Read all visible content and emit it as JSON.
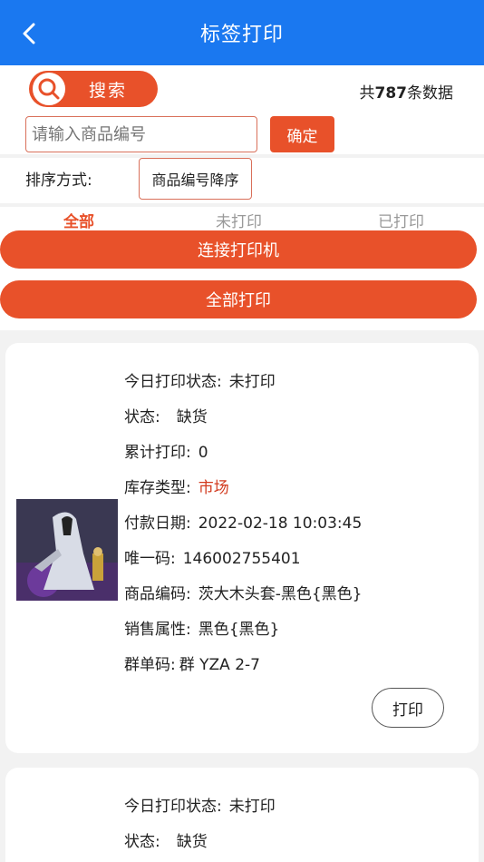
{
  "header": {
    "title": "标签打印"
  },
  "search": {
    "button_label": "搜索",
    "count_prefix": "共",
    "count_value": "787",
    "count_suffix": "条数据",
    "input_placeholder": "请输入商品编号",
    "confirm_label": "确定"
  },
  "sort": {
    "label": "排序方式:",
    "value": "商品编号降序"
  },
  "tabs": [
    {
      "label": "全部",
      "active": true
    },
    {
      "label": "未打印",
      "active": false
    },
    {
      "label": "已打印",
      "active": false
    }
  ],
  "actions": {
    "connect_label": "连接打印机",
    "print_all_label": "全部打印"
  },
  "cards": [
    {
      "rows": [
        {
          "label": "今日打印状态:",
          "value": "未打印"
        },
        {
          "label": "状态:",
          "value": "缺货"
        },
        {
          "label": "累计打印:",
          "value": "0"
        },
        {
          "label": "库存类型:",
          "value": "市场"
        },
        {
          "label": "付款日期:",
          "value": "2022-02-18 10:03:45"
        },
        {
          "label": "唯一码:",
          "value": "146002755401"
        },
        {
          "label": "商品编码:",
          "value": "茨大木头套-黑色{黑色}"
        },
        {
          "label": "销售属性:",
          "value": "黑色{黑色}"
        },
        {
          "label": "群单码:",
          "value": "群 YZA 2-7"
        }
      ],
      "print_label": "打印"
    },
    {
      "rows": [
        {
          "label": "今日打印状态:",
          "value": "未打印"
        },
        {
          "label": "状态:",
          "value": "缺货"
        }
      ]
    }
  ],
  "colors": {
    "header": "#1a78f0",
    "accent": "#e8512a",
    "market": "#d23a1e"
  }
}
